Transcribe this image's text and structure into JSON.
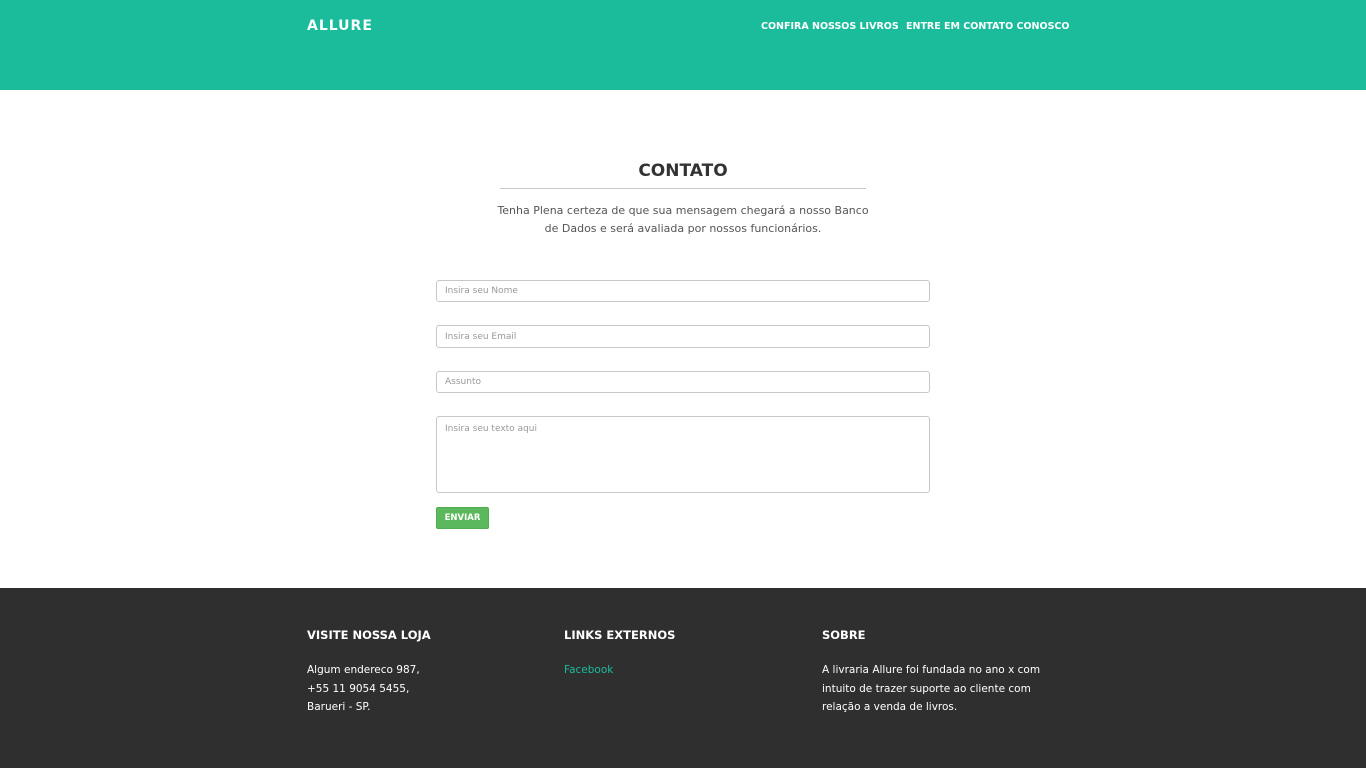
{
  "navbar": {
    "brand": "ALLURE",
    "links": [
      "CONFIRA NOSSOS LIVROS",
      "ENTRE EM CONTATO CONOSCO"
    ]
  },
  "contact": {
    "title": "CONTATO",
    "subtitle": "Tenha Plena certeza de que sua mensagem chegará a nosso Banco de Dados e será avaliada por nossos funcionários.",
    "form": {
      "name_placeholder": "Insira seu Nome",
      "email_placeholder": "Insira seu Email",
      "subject_placeholder": "Assunto",
      "message_placeholder": "Insira seu texto aqui",
      "submit_label": "ENVIAR"
    }
  },
  "footer": {
    "store": {
      "heading": "VISITE NOSSA LOJA",
      "lines": [
        "Algum endereco 987,",
        "+55 11 9054 5455,",
        "Barueri - SP."
      ]
    },
    "links": {
      "heading": "LINKS EXTERNOS",
      "items": [
        "Facebook"
      ]
    },
    "about": {
      "heading": "SOBRE",
      "lines": [
        "A livraria Allure foi fundada no ano x com",
        "intuito de trazer suporte ao cliente com",
        "relação a venda de livros."
      ]
    }
  },
  "colors": {
    "primary": "#1abc9c",
    "footer_bg": "#2f2f2f",
    "button": "#5cb85c"
  }
}
